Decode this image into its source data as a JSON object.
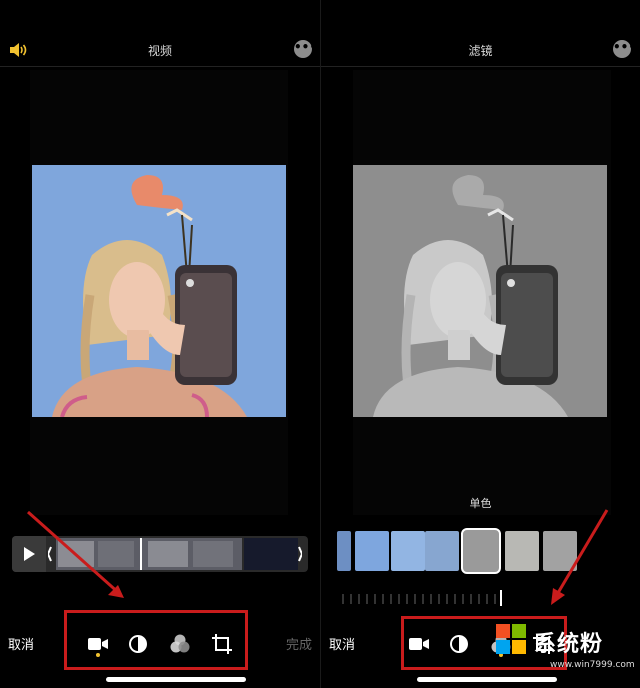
{
  "left": {
    "title": "视频",
    "more_label": "•••",
    "cancel_label": "取消",
    "done_label": "完成"
  },
  "right": {
    "title": "滤镜",
    "more_label": "•••",
    "filter_name": "单色",
    "cancel_label": "取消"
  },
  "watermark": {
    "brand": "系统粉",
    "url": "www.win7999.com"
  },
  "colors": {
    "accent": "#f2c230",
    "highlight_box": "#c91c1c",
    "sky": "#7fa6dc"
  }
}
